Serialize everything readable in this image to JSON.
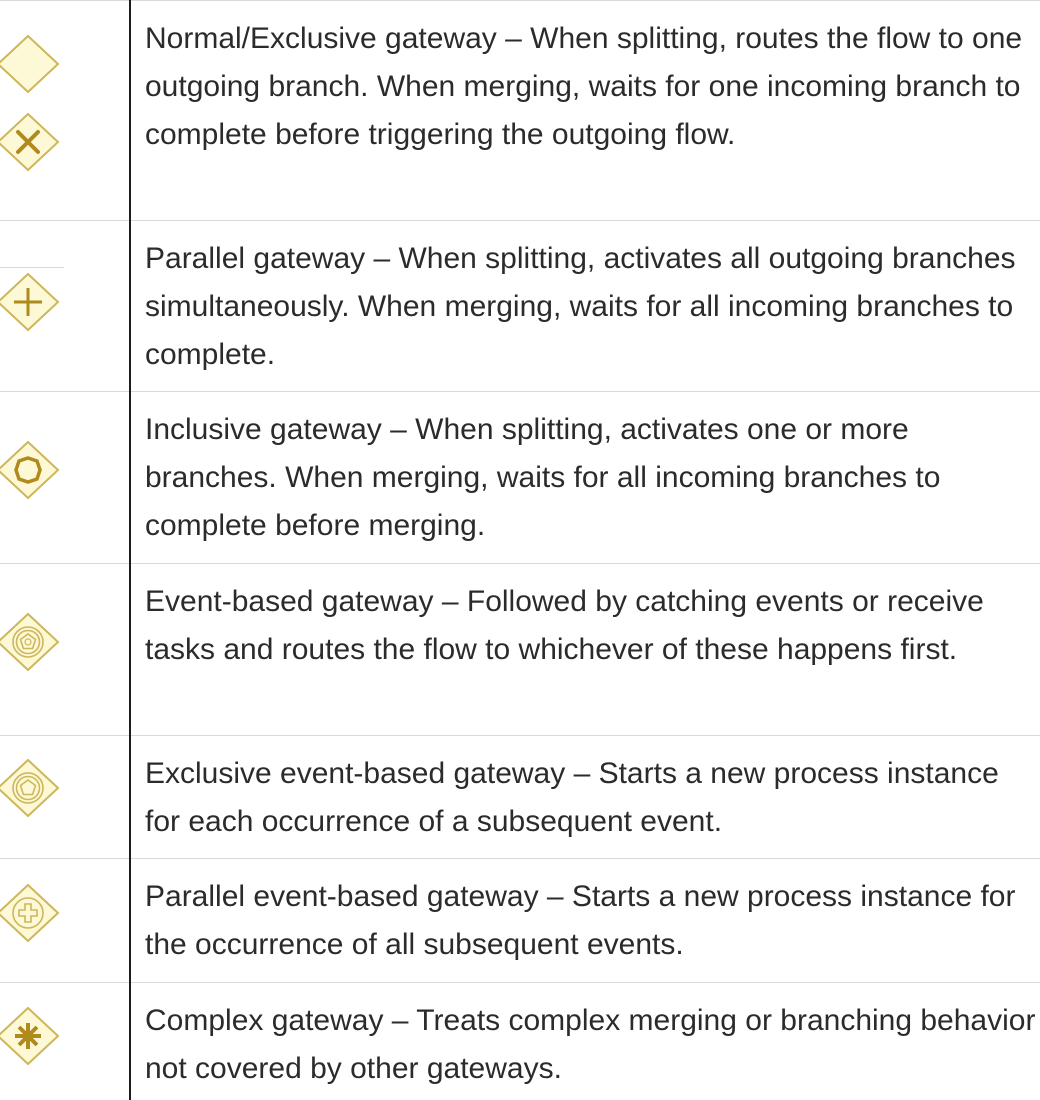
{
  "gateways": [
    {
      "icon": "exclusive-gateway-icons",
      "text": "Normal/Exclusive gateway – When splitting, routes the flow to one outgoing branch. When merging, waits for one incoming branch to complete before triggering the outgoing flow."
    },
    {
      "icon": "parallel-gateway-icon",
      "text": "Parallel gateway – When splitting, activates all outgoing branches simultaneously. When merging, waits for all incoming branches to complete."
    },
    {
      "icon": "inclusive-gateway-icon",
      "text": "Inclusive gateway – When splitting, activates one or more branches. When merging, waits for all incoming branches to complete before merging."
    },
    {
      "icon": "event-based-gateway-icon",
      "text": "Event-based gateway – Followed by catching events or receive tasks and routes the flow to whichever of these happens first."
    },
    {
      "icon": "exclusive-event-based-gateway-icon",
      "text": "Exclusive event-based gateway – Starts a new process instance for each occurrence of a subsequent event."
    },
    {
      "icon": "parallel-event-based-gateway-icon",
      "text": "Parallel event-based gateway – Starts a new process instance for the occurrence of all subsequent events."
    },
    {
      "icon": "complex-gateway-icon",
      "text": "Complex gateway – Treats complex merging or branching behavior not covered by other gateways."
    }
  ],
  "colors": {
    "gateway_fill": "#fdf8d6",
    "gateway_stroke": "#cdb75a",
    "marker": "#b08a1c",
    "divider": "#d9d9d9",
    "column_line": "#1c1c1c"
  }
}
